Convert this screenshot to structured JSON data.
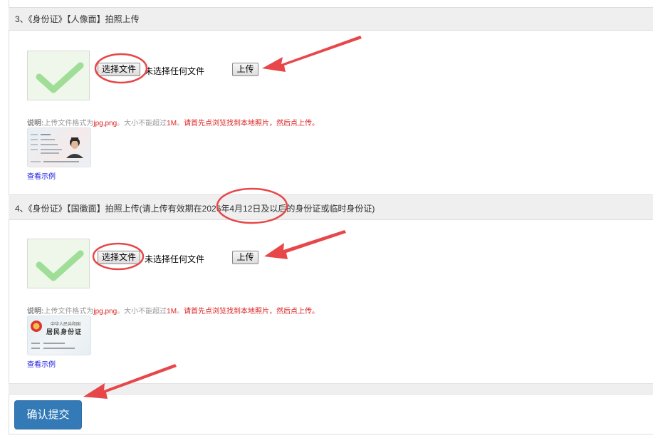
{
  "sections": [
    {
      "header": "3、《身份证》【人像面】拍照上传",
      "choose_file_label": "选择文件",
      "no_file_text": "未选择任何文件",
      "upload_label": "上传",
      "note_label": "说明:",
      "note_part1": "上传文件格式为",
      "note_formats": "jpg,png",
      "note_part2": "。大小不能超过",
      "note_size": "1M",
      "note_part3": "。",
      "note_warning": "请首先点浏览找到本地照片，然后点上传。",
      "sample_link": "查看示例"
    },
    {
      "header": "4、《身份证》【国徽面】拍照上传(请上传有效期在2026年4月12日及以后的身份证或临时身份证)",
      "choose_file_label": "选择文件",
      "no_file_text": "未选择任何文件",
      "upload_label": "上传",
      "note_label": "说明:",
      "note_part1": "上传文件格式为",
      "note_formats": "jpg,png",
      "note_part2": "。大小不能超过",
      "note_size": "1M",
      "note_part3": "。",
      "note_warning": "请首先点浏览找到本地照片，然后点上传。",
      "sample_link": "查看示例",
      "sample_card_line1": "中华人民共和国",
      "sample_card_line2": "居民身份证"
    }
  ],
  "submit_label": "确认提交",
  "colors": {
    "annotation": "#e8474a",
    "primary_button": "#337ab7",
    "checkmark": "#92d98a",
    "link": "#1a1ae6",
    "warning": "#d22222"
  },
  "icons": {
    "upload_preview": "checkmark-icon",
    "emblem": "national-emblem-icon"
  }
}
